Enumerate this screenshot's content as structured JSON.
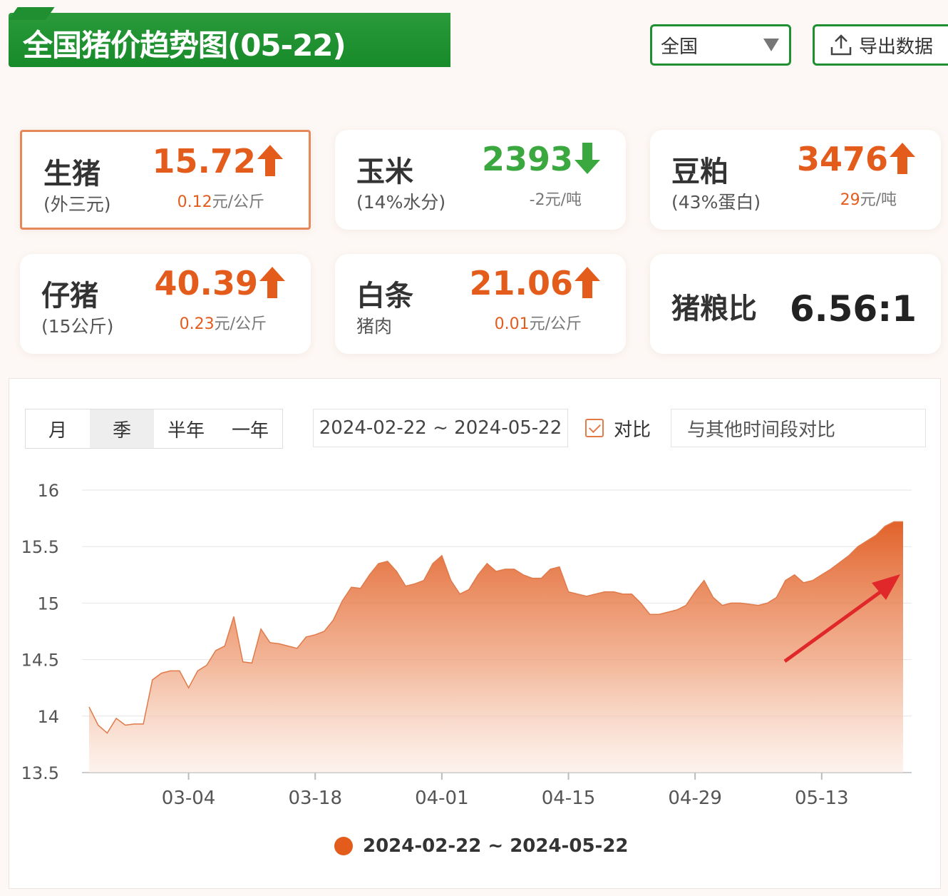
{
  "header": {
    "title": "全国猪价趋势图(05-22)",
    "region_select": "全国",
    "export_label": "导出数据"
  },
  "cards": [
    {
      "name": "生猪",
      "sub": "(外三元)",
      "price": "15.72",
      "direction": "up",
      "change_num": "0.12",
      "change_unit": "元/公斤"
    },
    {
      "name": "玉米",
      "sub": "(14%水分)",
      "price": "2393",
      "direction": "down",
      "change_num": "-2",
      "change_unit": "元/吨"
    },
    {
      "name": "豆粕",
      "sub": "(43%蛋白)",
      "price": "3476",
      "direction": "up",
      "change_num": "29",
      "change_unit": "元/吨"
    },
    {
      "name": "仔猪",
      "sub": "(15公斤)",
      "price": "40.39",
      "direction": "up",
      "change_num": "0.23",
      "change_unit": "元/公斤"
    },
    {
      "name": "白条",
      "sub": "猪肉",
      "price": "21.06",
      "direction": "up",
      "change_num": "0.01",
      "change_unit": "元/公斤"
    },
    {
      "name": "猪粮比",
      "ratio": "6.56:1"
    }
  ],
  "controls": {
    "periods": [
      "月",
      "季",
      "半年",
      "一年"
    ],
    "selected_period": "季",
    "date_range": "2024-02-22 ~ 2024-05-22",
    "compare_checked": true,
    "compare_label": "对比",
    "compare_placeholder": "与其他时间段对比"
  },
  "colors": {
    "brand_green": "#1f8f31",
    "up": "#e35c1c",
    "down": "#3aa83f",
    "series": "#e35c1c",
    "annotation_arrow": "#e0282a"
  },
  "chart_data": {
    "type": "area",
    "title": "",
    "xlabel": "",
    "ylabel": "",
    "ylim": [
      13.5,
      16
    ],
    "yticks": [
      "16",
      "15.5",
      "15",
      "14.5",
      "14",
      "13.5"
    ],
    "xticks": [
      {
        "label": "03-04",
        "date": "2024-03-04"
      },
      {
        "label": "03-18",
        "date": "2024-03-18"
      },
      {
        "label": "04-01",
        "date": "2024-04-01"
      },
      {
        "label": "04-15",
        "date": "2024-04-15"
      },
      {
        "label": "04-29",
        "date": "2024-04-29"
      },
      {
        "label": "05-13",
        "date": "2024-05-13"
      }
    ],
    "grid": true,
    "legend": "bottom-center",
    "series": [
      {
        "name": "2024-02-22 ~ 2024-05-22",
        "x": [
          "2024-02-22",
          "2024-02-23",
          "2024-02-24",
          "2024-02-25",
          "2024-02-26",
          "2024-02-27",
          "2024-02-28",
          "2024-02-29",
          "2024-03-01",
          "2024-03-02",
          "2024-03-03",
          "2024-03-04",
          "2024-03-05",
          "2024-03-06",
          "2024-03-07",
          "2024-03-08",
          "2024-03-09",
          "2024-03-10",
          "2024-03-11",
          "2024-03-12",
          "2024-03-13",
          "2024-03-14",
          "2024-03-15",
          "2024-03-16",
          "2024-03-17",
          "2024-03-18",
          "2024-03-19",
          "2024-03-20",
          "2024-03-21",
          "2024-03-22",
          "2024-03-23",
          "2024-03-24",
          "2024-03-25",
          "2024-03-26",
          "2024-03-27",
          "2024-03-28",
          "2024-03-29",
          "2024-03-30",
          "2024-03-31",
          "2024-04-01",
          "2024-04-02",
          "2024-04-03",
          "2024-04-04",
          "2024-04-05",
          "2024-04-06",
          "2024-04-07",
          "2024-04-08",
          "2024-04-09",
          "2024-04-10",
          "2024-04-11",
          "2024-04-12",
          "2024-04-13",
          "2024-04-14",
          "2024-04-15",
          "2024-04-16",
          "2024-04-17",
          "2024-04-18",
          "2024-04-19",
          "2024-04-20",
          "2024-04-21",
          "2024-04-22",
          "2024-04-23",
          "2024-04-24",
          "2024-04-25",
          "2024-04-26",
          "2024-04-27",
          "2024-04-28",
          "2024-04-29",
          "2024-04-30",
          "2024-05-01",
          "2024-05-02",
          "2024-05-03",
          "2024-05-04",
          "2024-05-05",
          "2024-05-06",
          "2024-05-07",
          "2024-05-08",
          "2024-05-09",
          "2024-05-10",
          "2024-05-11",
          "2024-05-12",
          "2024-05-13",
          "2024-05-14",
          "2024-05-15",
          "2024-05-16",
          "2024-05-17",
          "2024-05-18",
          "2024-05-19",
          "2024-05-20",
          "2024-05-21",
          "2024-05-22"
        ],
        "values": [
          14.08,
          13.92,
          13.85,
          13.98,
          13.92,
          13.93,
          13.93,
          14.32,
          14.38,
          14.4,
          14.4,
          14.25,
          14.4,
          14.45,
          14.58,
          14.62,
          14.88,
          14.48,
          14.47,
          14.77,
          14.65,
          14.64,
          14.62,
          14.6,
          14.7,
          14.72,
          14.75,
          14.85,
          15.02,
          15.14,
          15.13,
          15.25,
          15.35,
          15.37,
          15.28,
          15.15,
          15.17,
          15.2,
          15.35,
          15.42,
          15.2,
          15.08,
          15.12,
          15.25,
          15.35,
          15.28,
          15.3,
          15.3,
          15.25,
          15.22,
          15.22,
          15.3,
          15.32,
          15.1,
          15.08,
          15.06,
          15.08,
          15.1,
          15.1,
          15.08,
          15.08,
          15.0,
          14.9,
          14.9,
          14.92,
          14.94,
          14.98,
          15.1,
          15.2,
          15.05,
          14.98,
          15.0,
          15.0,
          14.99,
          14.98,
          15.0,
          15.05,
          15.2,
          15.25,
          15.18,
          15.2,
          15.25,
          15.3,
          15.36,
          15.42,
          15.5,
          15.55,
          15.6,
          15.68,
          15.72,
          15.72
        ]
      }
    ]
  }
}
